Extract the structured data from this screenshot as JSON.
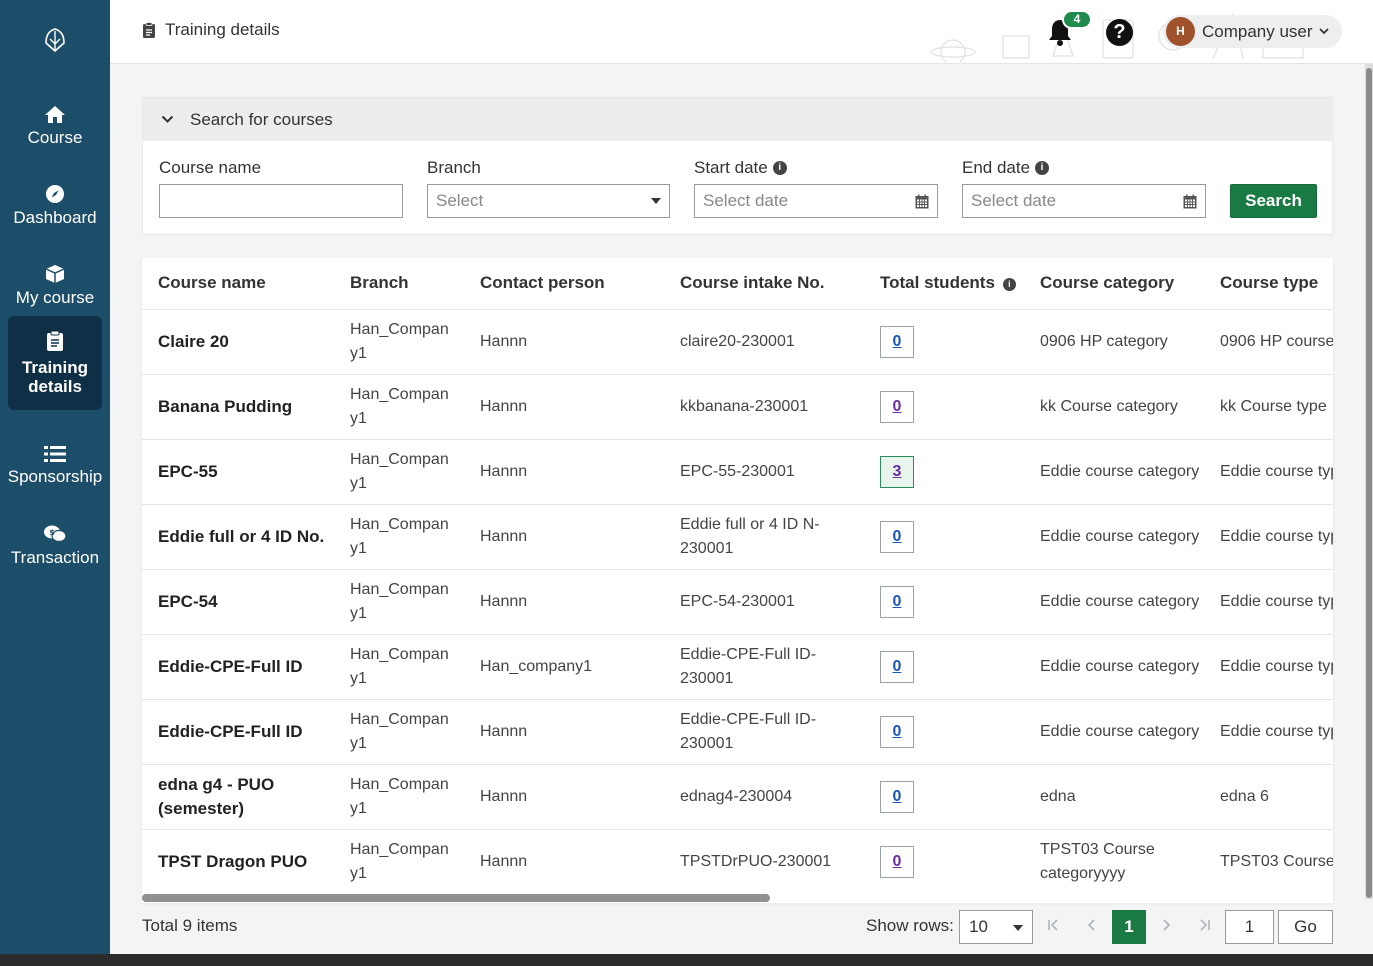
{
  "sidebar": {
    "logo_icon": "leaf-book-logo",
    "items": [
      {
        "label": "Course",
        "icon": "home-icon"
      },
      {
        "label": "Dashboard",
        "icon": "compass-icon"
      },
      {
        "label": "My course",
        "icon": "box-icon"
      },
      {
        "label": "Training details",
        "label_line1": "Training",
        "label_line2": "details",
        "icon": "clipboard-icon",
        "active": true
      },
      {
        "label": "Sponsorship",
        "icon": "list-icon"
      },
      {
        "label": "Transaction",
        "icon": "money-chat-icon"
      }
    ]
  },
  "header": {
    "title": "Training details",
    "notifications_count": "4",
    "help_label": "?",
    "user_initial": "H",
    "user_name": "Company user"
  },
  "search": {
    "panel_title": "Search for courses",
    "course_name_label": "Course name",
    "course_name_value": "",
    "branch_label": "Branch",
    "branch_placeholder": "Select",
    "start_date_label": "Start date",
    "start_date_placeholder": "Select date",
    "end_date_label": "End date",
    "end_date_placeholder": "Select date",
    "search_button": "Search"
  },
  "table": {
    "columns": [
      "Course name",
      "Branch",
      "Contact person",
      "Course intake No.",
      "Total students",
      "Course category",
      "Course type"
    ],
    "rows": [
      {
        "course_name": "Claire 20",
        "branch": "Han_Company1",
        "contact": "Hannn",
        "intake": "claire20-230001",
        "students": "0",
        "category": "0906 HP category",
        "type": "0906 HP course"
      },
      {
        "course_name": "Banana Pudding",
        "branch": "Han_Company1",
        "contact": "Hannn",
        "intake": "kkbanana-230001",
        "students": "0",
        "category": "kk Course category",
        "type": "kk Course type"
      },
      {
        "course_name": "EPC-55",
        "branch": "Han_Company1",
        "contact": "Hannn",
        "intake": "EPC-55-230001",
        "students": "3",
        "category": "Eddie course category",
        "type": "Eddie course type"
      },
      {
        "course_name": "Eddie full or 4 ID No.",
        "branch": "Han_Company1",
        "contact": "Hannn",
        "intake": "Eddie full or 4 ID N-230001",
        "students": "0",
        "category": "Eddie course category",
        "type": "Eddie course type"
      },
      {
        "course_name": "EPC-54",
        "branch": "Han_Company1",
        "contact": "Hannn",
        "intake": "EPC-54-230001",
        "students": "0",
        "category": "Eddie course category",
        "type": "Eddie course type"
      },
      {
        "course_name": "Eddie-CPE-Full ID",
        "branch": "Han_Company1",
        "contact": "Han_company1",
        "intake": "Eddie-CPE-Full ID-230001",
        "students": "0",
        "category": "Eddie course category",
        "type": "Eddie course type"
      },
      {
        "course_name": "Eddie-CPE-Full ID",
        "branch": "Han_Company1",
        "contact": "Hannn",
        "intake": "Eddie-CPE-Full ID-230001",
        "students": "0",
        "category": "Eddie course category",
        "type": "Eddie course type"
      },
      {
        "course_name": "edna g4 - PUO (semester)",
        "branch": "Han_Company1",
        "contact": "Hannn",
        "intake": "ednag4-230004",
        "students": "0",
        "category": "edna",
        "type": "edna 6"
      },
      {
        "course_name": "TPST Dragon PUO",
        "branch": "Han_Company1",
        "contact": "Hannn",
        "intake": "TPSTDrPUO-230001",
        "students": "0",
        "category": "TPST03 Course categoryyyy",
        "type": "TPST03 Course"
      }
    ]
  },
  "footer": {
    "total": "Total 9 items",
    "show_rows_label": "Show rows:",
    "rows_value": "10",
    "current_page": "1",
    "page_input": "1",
    "go_button": "Go"
  },
  "colors": {
    "sidebar": "#1d4e69",
    "sidebar_active": "#0e2f45",
    "accent_green": "#1a7a44",
    "link_blue": "#1a56b8"
  }
}
